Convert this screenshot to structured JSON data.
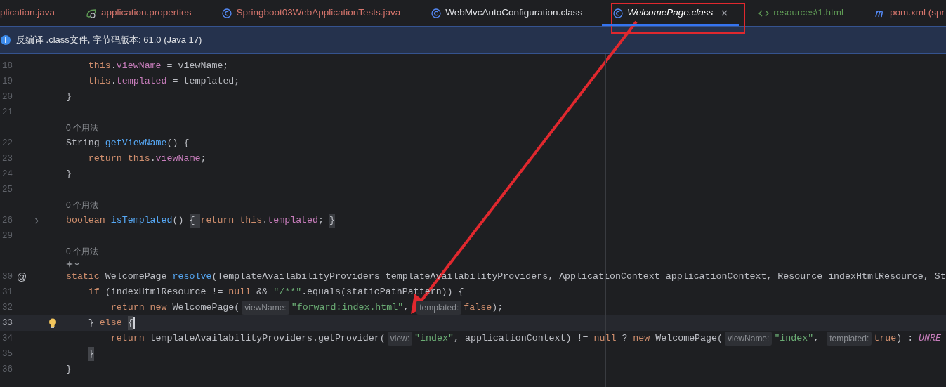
{
  "tabs": [
    {
      "label": "plication.java",
      "kind": "java",
      "color": "#d5756c",
      "selected": false,
      "closable": false
    },
    {
      "label": "application.properties",
      "kind": "properties",
      "color": "#d5756c",
      "selected": false,
      "closable": false
    },
    {
      "label": "Springboot03WebApplicationTests.java",
      "kind": "class",
      "color": "#d5756c",
      "selected": false,
      "closable": false
    },
    {
      "label": "WebMvcAutoConfiguration.class",
      "kind": "class",
      "color": "#dfe1e5",
      "selected": false,
      "closable": false
    },
    {
      "label": "WelcomePage.class",
      "kind": "class",
      "color": "#ffffff",
      "selected": true,
      "closable": true
    },
    {
      "label": "resources\\1.html",
      "kind": "html",
      "color": "#5f9a55",
      "selected": false,
      "closable": false
    },
    {
      "label": "pom.xml (spr",
      "kind": "maven",
      "color": "#d5756c",
      "selected": false,
      "closable": false
    }
  ],
  "banner": {
    "text": "反编译 .class文件, 字节码版本: 61.0 (Java 17)"
  },
  "editor": {
    "lines": [
      {
        "kind": "code",
        "number": "18",
        "current": false,
        "tokens": [
          {
            "kind": "keyword",
            "text": "        this"
          },
          {
            "kind": "plain",
            "text": "."
          },
          {
            "kind": "field",
            "text": "viewName"
          },
          {
            "kind": "plain",
            "text": " = viewName;"
          }
        ]
      },
      {
        "kind": "code",
        "number": "19",
        "current": false,
        "tokens": [
          {
            "kind": "keyword",
            "text": "        this"
          },
          {
            "kind": "plain",
            "text": "."
          },
          {
            "kind": "field",
            "text": "templated"
          },
          {
            "kind": "plain",
            "text": " = templated;"
          }
        ]
      },
      {
        "kind": "code",
        "number": "20",
        "current": false,
        "tokens": [
          {
            "kind": "plain",
            "text": "    }"
          }
        ]
      },
      {
        "kind": "code",
        "number": "21",
        "current": false
      },
      {
        "kind": "usage",
        "text": "0 个用法"
      },
      {
        "kind": "code",
        "number": "22",
        "current": false,
        "tokens": [
          {
            "kind": "plain",
            "text": "    String "
          },
          {
            "kind": "function",
            "text": "getViewName"
          },
          {
            "kind": "plain",
            "text": "() {"
          }
        ]
      },
      {
        "kind": "code",
        "number": "23",
        "current": false,
        "tokens": [
          {
            "kind": "keyword",
            "text": "        return this"
          },
          {
            "kind": "plain",
            "text": "."
          },
          {
            "kind": "field",
            "text": "viewName"
          },
          {
            "kind": "plain",
            "text": ";"
          }
        ]
      },
      {
        "kind": "code",
        "number": "24",
        "current": false,
        "tokens": [
          {
            "kind": "plain",
            "text": "    }"
          }
        ]
      },
      {
        "kind": "code",
        "number": "25",
        "current": false
      },
      {
        "kind": "usage",
        "text": "0 个用法"
      },
      {
        "kind": "code",
        "number": "26",
        "current": false,
        "fold": true,
        "tokens": [
          {
            "kind": "keyword",
            "text": "    boolean "
          },
          {
            "kind": "function",
            "text": "isTemplated"
          },
          {
            "kind": "plain",
            "text": "() "
          },
          {
            "kind": "folded",
            "text": "{ "
          },
          {
            "kind": "keyword",
            "text": "return this"
          },
          {
            "kind": "plain",
            "text": "."
          },
          {
            "kind": "field",
            "text": "templated"
          },
          {
            "kind": "plain",
            "text": ";"
          },
          {
            "kind": "folded",
            "text": " }"
          }
        ]
      },
      {
        "kind": "code",
        "number": "29",
        "current": false
      },
      {
        "kind": "usage",
        "text": "0 个用法"
      },
      {
        "kind": "ai"
      },
      {
        "kind": "code",
        "number": "30",
        "current": false,
        "gutter": "@",
        "tokens": [
          {
            "kind": "keyword",
            "text": "    static "
          },
          {
            "kind": "plain",
            "text": "WelcomePage "
          },
          {
            "kind": "function",
            "text": "resolve"
          },
          {
            "kind": "plain",
            "text": "(TemplateAvailabilityProviders templateAvailabilityProviders, ApplicationContext applicationContext, Resource indexHtmlResource, St"
          }
        ]
      },
      {
        "kind": "code",
        "number": "31",
        "current": false,
        "tokens": [
          {
            "kind": "keyword",
            "text": "        if "
          },
          {
            "kind": "plain",
            "text": "(indexHtmlResource != "
          },
          {
            "kind": "keyword",
            "text": "null"
          },
          {
            "kind": "plain",
            "text": " && "
          },
          {
            "kind": "string",
            "text": "\"/**\""
          },
          {
            "kind": "plain",
            "text": ".equals(staticPathPattern)) {"
          }
        ]
      },
      {
        "kind": "code",
        "number": "32",
        "current": false,
        "tokens": [
          {
            "kind": "keyword",
            "text": "            return new "
          },
          {
            "kind": "plain",
            "text": "WelcomePage("
          },
          {
            "kind": "hint",
            "text": "viewName:"
          },
          {
            "kind": "string",
            "text": "\"forward:index.html\""
          },
          {
            "kind": "plain",
            "text": ", "
          },
          {
            "kind": "hint",
            "text": "templated:"
          },
          {
            "kind": "keyword",
            "text": "false"
          },
          {
            "kind": "plain",
            "text": ");"
          }
        ]
      },
      {
        "kind": "code",
        "number": "33",
        "current": true,
        "bulb": true,
        "tokens": [
          {
            "kind": "plain",
            "text": "        } "
          },
          {
            "kind": "keyword",
            "text": "else "
          },
          {
            "kind": "match",
            "text": "{"
          }
        ]
      },
      {
        "kind": "code",
        "number": "34",
        "current": false,
        "tokens": [
          {
            "kind": "keyword",
            "text": "            return "
          },
          {
            "kind": "plain",
            "text": "templateAvailabilityProviders.getProvider("
          },
          {
            "kind": "hint",
            "text": "view:"
          },
          {
            "kind": "string",
            "text": "\"index\""
          },
          {
            "kind": "plain",
            "text": ", applicationContext) != "
          },
          {
            "kind": "keyword",
            "text": "null"
          },
          {
            "kind": "plain",
            "text": " ? "
          },
          {
            "kind": "keyword",
            "text": "new "
          },
          {
            "kind": "plain",
            "text": "WelcomePage("
          },
          {
            "kind": "hint",
            "text": "viewName:"
          },
          {
            "kind": "string",
            "text": "\"index\""
          },
          {
            "kind": "plain",
            "text": ", "
          },
          {
            "kind": "hint",
            "text": "templated:"
          },
          {
            "kind": "keyword",
            "text": "true"
          },
          {
            "kind": "plain",
            "text": ") : "
          },
          {
            "kind": "constant",
            "text": "UNRE"
          }
        ]
      },
      {
        "kind": "code",
        "number": "35",
        "current": false,
        "tokens": [
          {
            "kind": "match",
            "text": "        }"
          }
        ]
      },
      {
        "kind": "code",
        "number": "36",
        "current": false,
        "tokens": [
          {
            "kind": "plain",
            "text": "    }"
          }
        ]
      }
    ]
  }
}
